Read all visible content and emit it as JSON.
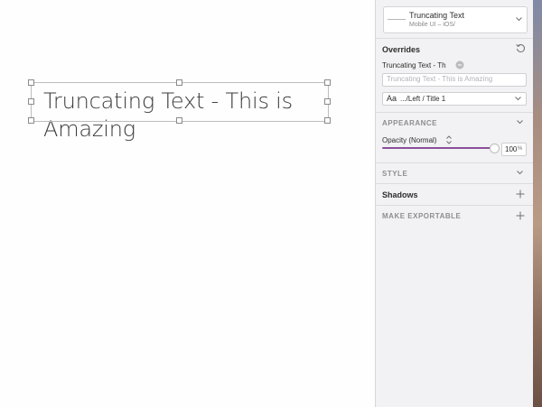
{
  "canvas": {
    "text_layer": "Truncating Text - This is Amazing"
  },
  "inspector": {
    "symbol": {
      "name": "Truncating Text",
      "library": "Mobile UI – iOS/"
    },
    "overrides": {
      "title": "Overrides",
      "reset_icon": "reset-icon",
      "text_override_label": "Truncating Text - Th",
      "text_override_placeholder": "Truncating Text - This is Amazing",
      "text_style_prefix": "Aa",
      "text_style_value": ".../Left / Title 1"
    },
    "appearance": {
      "title": "APPEARANCE",
      "opacity_label": "Opacity (Normal)",
      "opacity_value": "100",
      "opacity_unit": "%",
      "opacity_level": 1.0
    },
    "style": {
      "title": "STYLE"
    },
    "shadows": {
      "title": "Shadows"
    },
    "exportable": {
      "title": "MAKE EXPORTABLE"
    }
  },
  "colors": {
    "accent": "#8a4f99",
    "panel_bg": "#f2f2f4",
    "canvas_bg": "#fefefe"
  }
}
